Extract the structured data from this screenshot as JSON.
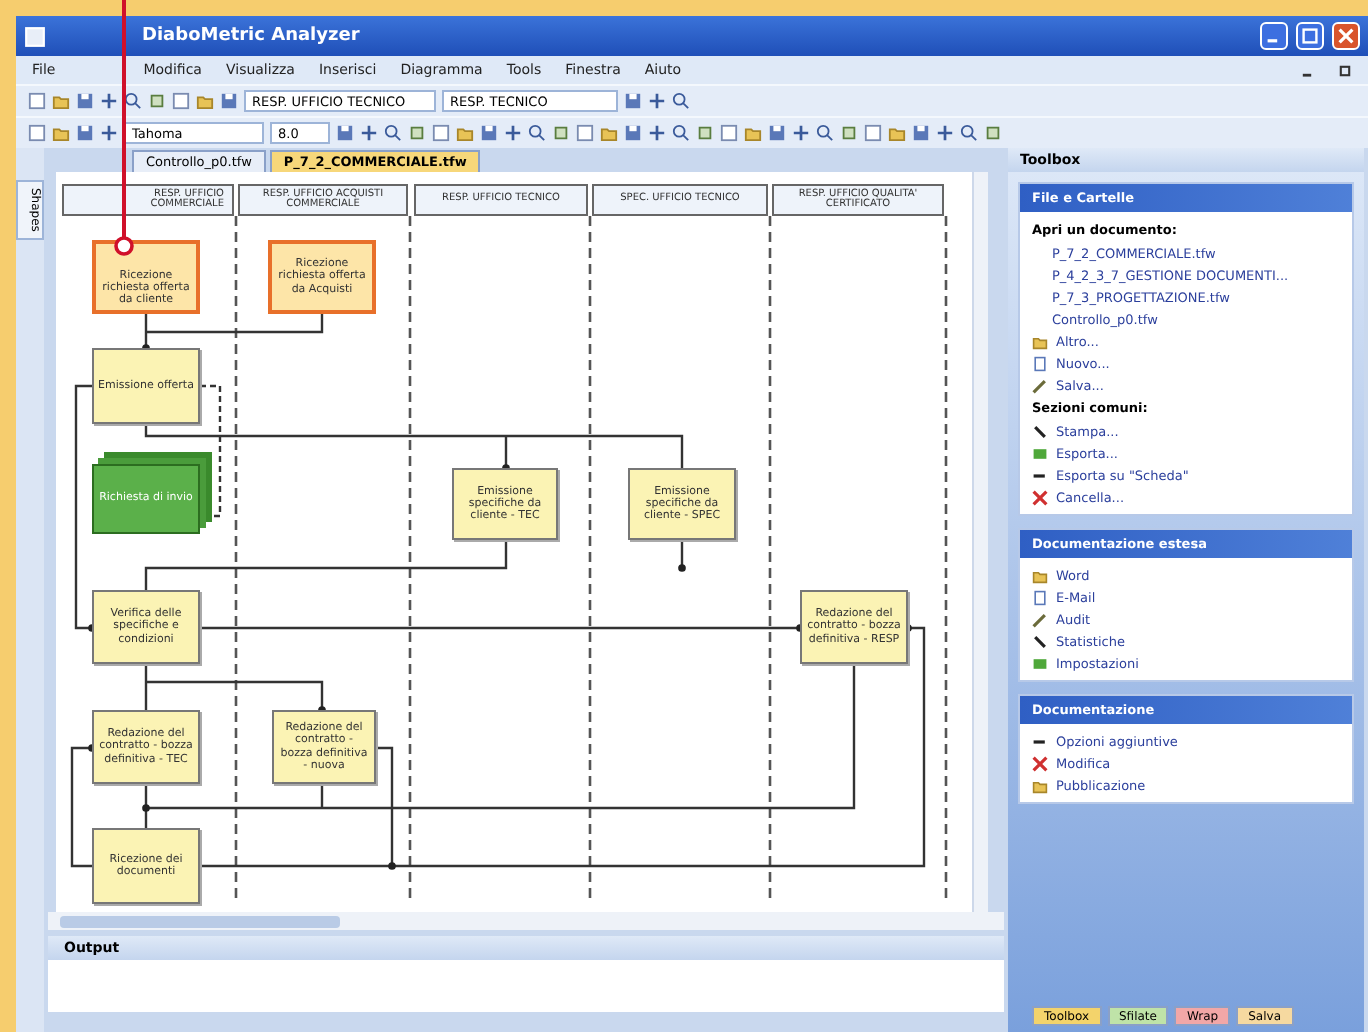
{
  "window": {
    "title": "DiaboMetric Analyzer"
  },
  "menu": [
    "File",
    "Modifica",
    "Visualizza",
    "Inserisci",
    "Diagramma",
    "Tools",
    "Finestra",
    "Aiuto"
  ],
  "toolbars": [
    {
      "combos": [
        "RESP. UFFICIO TECNICO",
        "RESP. TECNICO"
      ]
    },
    {
      "combos": [
        "Tahoma",
        "8.0"
      ]
    }
  ],
  "left_tabs": [
    "Shapes"
  ],
  "document_tabs": [
    {
      "label": "Controllo_p0.tfw",
      "selected": false
    },
    {
      "label": "P_7_2_COMMERCIALE.tfw",
      "selected": true
    }
  ],
  "diagram": {
    "lanes": [
      "RESP. UFFICIO COMMERCIALE",
      "RESP. UFFICIO ACQUISTI COMMERCIALE",
      "RESP. UFFICIO TECNICO",
      "SPEC. UFFICIO TECNICO",
      "RESP. UFFICIO QUALITA' CERTIFICATO"
    ],
    "nodes": [
      {
        "kind": "start",
        "text": "Ricezione richiesta offerta da cliente"
      },
      {
        "kind": "start",
        "text": "Ricezione richiesta offerta da Acquisti"
      },
      {
        "kind": "process",
        "text": "Emissione offerta"
      },
      {
        "kind": "document",
        "text": "Richiesta di invio"
      },
      {
        "kind": "process",
        "text": "Emissione specifiche da cliente - TEC"
      },
      {
        "kind": "process",
        "text": "Emissione specifiche da cliente - SPEC"
      },
      {
        "kind": "process",
        "text": "Verifica delle specifiche e condizioni"
      },
      {
        "kind": "process",
        "text": "Redazione del contratto - bozza definitiva - RESP"
      },
      {
        "kind": "process",
        "text": "Redazione del contratto - bozza definitiva - TEC"
      },
      {
        "kind": "process",
        "text": "Redazione del contratto - bozza definitiva - nuova"
      },
      {
        "kind": "process",
        "text": "Ricezione dei documenti"
      }
    ]
  },
  "output": {
    "title": "Output"
  },
  "task_pane": {
    "title": "Toolbox",
    "sections": [
      {
        "title": "File e Cartelle",
        "groups": [
          {
            "heading": "Apri un documento:",
            "items": [
              {
                "kind": "file",
                "label": "P_7_2_COMMERCIALE.tfw"
              },
              {
                "kind": "file",
                "label": "P_4_2_3_7_GESTIONE DOCUMENTI..."
              },
              {
                "kind": "file",
                "label": "P_7_3_PROGETTAZIONE.tfw"
              },
              {
                "kind": "file",
                "label": "Controllo_p0.tfw"
              },
              {
                "kind": "action",
                "label": "Altro..."
              },
              {
                "kind": "action",
                "label": "Nuovo..."
              },
              {
                "kind": "action",
                "label": "Salva..."
              }
            ]
          },
          {
            "heading": "Sezioni comuni:",
            "items": [
              {
                "kind": "action",
                "label": "Stampa..."
              },
              {
                "kind": "action",
                "label": "Esporta..."
              },
              {
                "kind": "action",
                "label": "Esporta su \"Scheda\""
              },
              {
                "kind": "action",
                "label": "Cancella..."
              }
            ]
          }
        ]
      },
      {
        "title": "Documentazione estesa",
        "groups": [
          {
            "items": [
              {
                "kind": "action",
                "label": "Word"
              },
              {
                "kind": "action",
                "label": "E-Mail"
              },
              {
                "kind": "action",
                "label": "Audit"
              },
              {
                "kind": "action",
                "label": "Statistiche"
              },
              {
                "kind": "action",
                "label": "Impostazioni"
              }
            ]
          }
        ]
      },
      {
        "title": "Documentazione",
        "groups": [
          {
            "items": [
              {
                "kind": "action",
                "label": "Opzioni aggiuntive"
              },
              {
                "kind": "action",
                "label": "Modifica"
              },
              {
                "kind": "action",
                "label": "Pubblicazione"
              }
            ]
          }
        ]
      }
    ]
  },
  "bottom_tabs": [
    {
      "label": "Toolbox",
      "color": "#f3d36b"
    },
    {
      "label": "Sfilate",
      "color": "#bfe3a8"
    },
    {
      "label": "Wrap",
      "color": "#f2a7a7"
    },
    {
      "label": "Salva",
      "color": "#f6d9a0"
    }
  ]
}
